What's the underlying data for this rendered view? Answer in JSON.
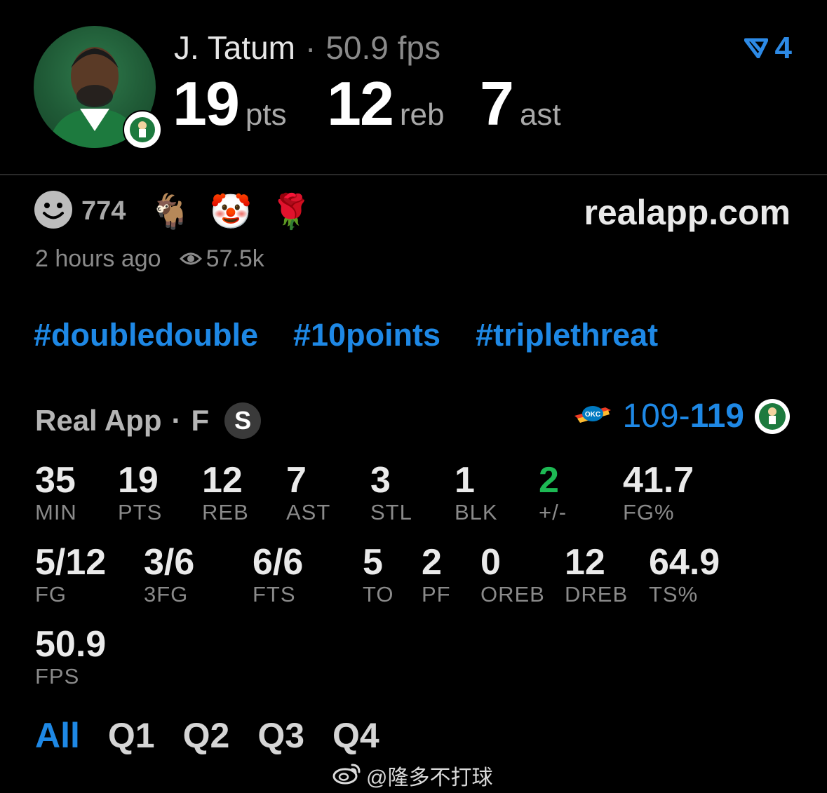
{
  "player": {
    "name": "J. Tatum",
    "separator": "·",
    "fps_label": "50.9 fps",
    "big_stats": [
      {
        "value": "19",
        "unit": "pts"
      },
      {
        "value": "12",
        "unit": "reb"
      },
      {
        "value": "7",
        "unit": "ast"
      }
    ]
  },
  "header": {
    "version_count": "4"
  },
  "reactions": {
    "count": "774",
    "emojis": [
      "🐐",
      "🤡",
      "🌹"
    ],
    "site": "realapp.com"
  },
  "meta": {
    "time": "2 hours ago",
    "views": "57.5k"
  },
  "hashtags": [
    "#doubledouble",
    "#10points",
    "#triplethreat"
  ],
  "game": {
    "source": "Real App",
    "separator": "·",
    "status": "F",
    "badge": "S",
    "score_away": "109",
    "score_dash": "-",
    "score_home": "119",
    "away_logo_text": "OKC"
  },
  "stats": {
    "row1": [
      {
        "value": "35",
        "label": "MIN"
      },
      {
        "value": "19",
        "label": "PTS"
      },
      {
        "value": "12",
        "label": "REB"
      },
      {
        "value": "7",
        "label": "AST"
      },
      {
        "value": "3",
        "label": "STL"
      },
      {
        "value": "1",
        "label": "BLK"
      },
      {
        "value": "2",
        "label": "+/-"
      },
      {
        "value": "41.7",
        "label": "FG%"
      }
    ],
    "row2": [
      {
        "value": "5/12",
        "label": "FG"
      },
      {
        "value": "3/6",
        "label": "3FG"
      },
      {
        "value": "6/6",
        "label": "FTS"
      },
      {
        "value": "5",
        "label": "TO"
      },
      {
        "value": "2",
        "label": "PF"
      },
      {
        "value": "0",
        "label": "OREB"
      },
      {
        "value": "12",
        "label": "DREB"
      },
      {
        "value": "64.9",
        "label": "TS%"
      }
    ],
    "row3": [
      {
        "value": "50.9",
        "label": "FPS"
      }
    ]
  },
  "tabs": [
    "All",
    "Q1",
    "Q2",
    "Q3",
    "Q4"
  ],
  "active_tab": "All",
  "watermark": "@隆多不打球",
  "colors": {
    "accent": "#1e88e5",
    "positive": "#1db954",
    "background": "#000000"
  }
}
